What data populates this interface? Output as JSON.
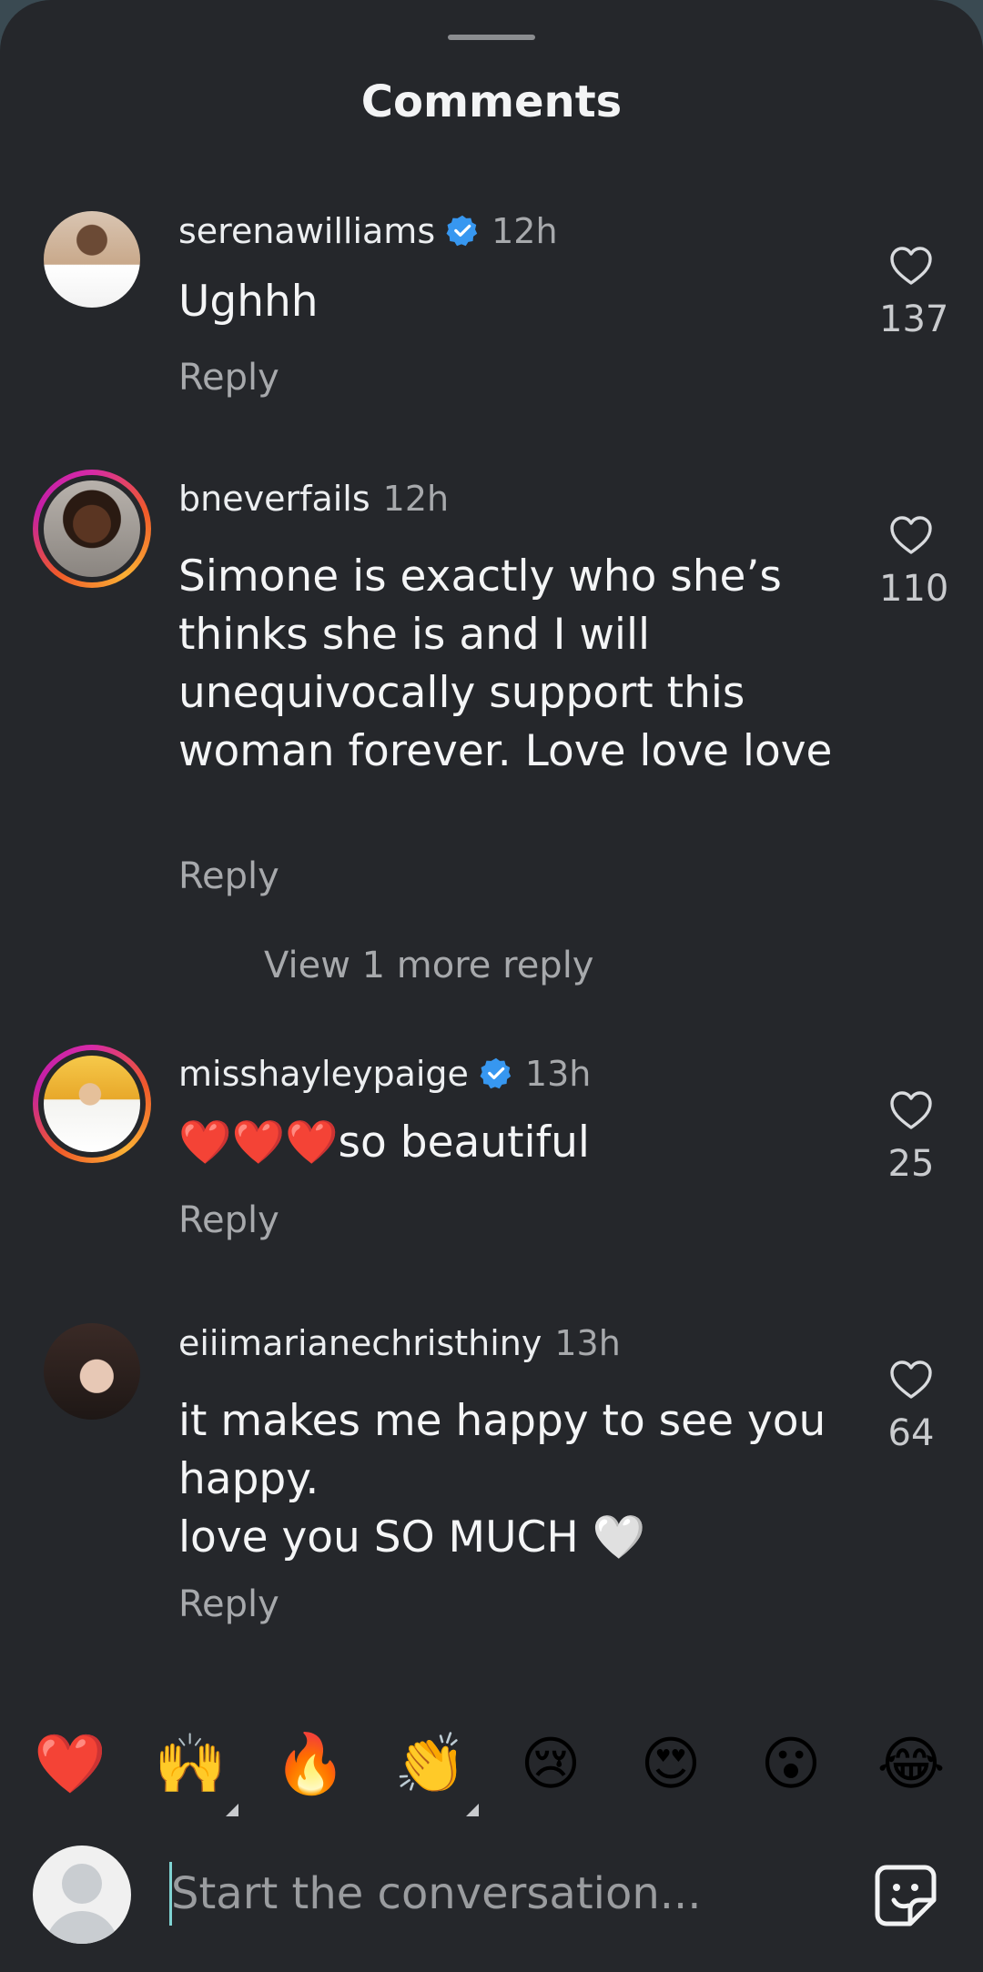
{
  "sheet": {
    "title": "Comments"
  },
  "comments": [
    {
      "username": "serenawilliams",
      "verified": true,
      "time": "12h",
      "text": "Ughhh",
      "reply": "Reply",
      "likes": "137"
    },
    {
      "username": "bneverfails",
      "verified": false,
      "time": "12h",
      "text": "Simone is exactly who she’s thinks she is and I will unequivocally support this woman forever. Love love love",
      "reply": "Reply",
      "likes": "110",
      "view_more": "View 1 more reply"
    },
    {
      "username": "misshayleypaige",
      "verified": true,
      "time": "13h",
      "text": "❤️❤️❤️so beautiful",
      "reply": "Reply",
      "likes": "25"
    },
    {
      "username": "eiiimarianechristhiny",
      "verified": false,
      "time": "13h",
      "text_line1": "it makes me happy to see you happy.",
      "text_line2": "love you SO MUCH 🤍",
      "reply": "Reply",
      "likes": "64"
    }
  ],
  "emoji_bar": [
    "❤️",
    "🙌",
    "🔥",
    "👏",
    "😢",
    "😍",
    "😮",
    "😂"
  ],
  "composer": {
    "placeholder": "Start the conversation..."
  },
  "colors": {
    "background": "#25272b",
    "verified_blue": "#3797f0",
    "muted_text": "#a7a9ac"
  },
  "icons": [
    "heart-outline-icon",
    "verified-badge-icon",
    "sticker-icon",
    "default-avatar-icon"
  ]
}
